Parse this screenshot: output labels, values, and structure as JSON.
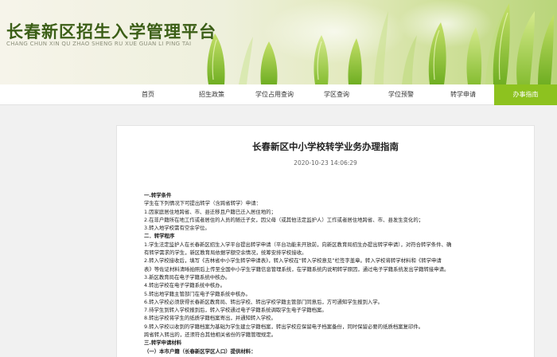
{
  "header": {
    "title": "长春新区招生入学管理平台",
    "subtitle": "CHANG CHUN XIN QU ZHAO SHENG RU XUE GUAN LI PING TAI"
  },
  "nav": {
    "items": [
      {
        "label": "首页",
        "active": false
      },
      {
        "label": "招生政策",
        "active": false
      },
      {
        "label": "学位占用查询",
        "active": false
      },
      {
        "label": "学区查询",
        "active": false
      },
      {
        "label": "学位预警",
        "active": false
      },
      {
        "label": "转学申请",
        "active": false
      },
      {
        "label": "办事指南",
        "active": true
      }
    ]
  },
  "article": {
    "title": "长春新区中小学校转学业务办理指南",
    "date": "2020-10-23 14:06:29",
    "lines": [
      {
        "text": "一.转学条件",
        "bold": true
      },
      {
        "text": "学生在下列情况下可提出转学（含跨省转学）申请：",
        "bold": false
      },
      {
        "text": "1.因家庭居住地跨省、市、县迁移且户籍已迁入居住地的；",
        "bold": false
      },
      {
        "text": "2.在非户籍所在地工作或者居住的人员的随迁子女，因父母（或其他法定监护人）工作或者居住地跨省、市、县发生变化的；",
        "bold": false
      },
      {
        "text": "3.转入地学校需有空余学位。",
        "bold": false
      },
      {
        "text": "二．转学程序",
        "bold": true
      },
      {
        "text": "1.学生法定监护人在长春新区招生入学平台提出转学申请（平台功能未开放前，向新区教育局招生办提出转学申请），对符合转学条件、确",
        "bold": false
      },
      {
        "text": "有转学需求的学生，新区教育局依据学额空余情况，统筹安排学校接收。",
        "bold": false
      },
      {
        "text": "2.转入学校接收后，填写《吉林省中小学生转学申请表》，转入学校在“转入学校意见”栏签字盖章。转入学校将转学材料和《转学申请",
        "bold": false
      },
      {
        "text": "表》等佐证材料清晰拍照后上传至全国中小学生学籍信息管理系统，在学籍系统内说明转学原因，通过电子学籍系统发出学籍转接申请。",
        "bold": false
      },
      {
        "text": "3.新区教育局在电子学籍系统中核办。",
        "bold": false
      },
      {
        "text": "4.转出学校在电子学籍系统中核办。",
        "bold": false
      },
      {
        "text": "5.转出地学籍主管部门在电子学籍系统中核办。",
        "bold": false
      },
      {
        "text": "6.转入学校必须获得长春新区教育局、转出学校、转出学校学籍主管部门同意后，方可通知学生报到入学。",
        "bold": false
      },
      {
        "text": "7.待学生到转入学校报到后，转入学校通过电子学籍系统调取学生电子学籍档案。",
        "bold": false
      },
      {
        "text": "8.转出学校将学生的纸质学籍档案寄出，并通知转入学校。",
        "bold": false
      },
      {
        "text": "9.转入学校以收到的学籍档案为基础为学生建立学籍档案，转出学校应保留电子档案备份，同时保留必要的纸质档案复印件。",
        "bold": false
      },
      {
        "text": "跨省转入转出的，还须符合其他相关省份的学籍管理规定。",
        "bold": false
      },
      {
        "text": "三.转学申请材料",
        "bold": true
      },
      {
        "text": "（一）本市户籍（长春新区学区人口）提供材料：",
        "bold": true
      }
    ]
  },
  "colors": {
    "accent": "#8dc21f",
    "title": "#3b5e16"
  }
}
